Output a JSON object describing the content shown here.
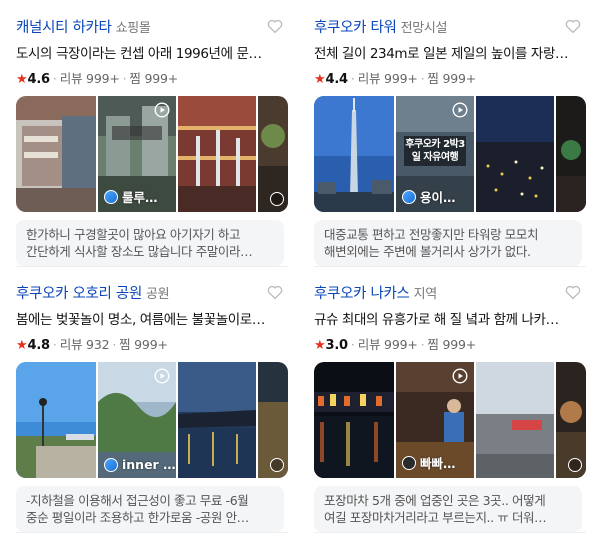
{
  "places": [
    {
      "name": "캐널시티 하카타",
      "category": "쇼핑몰",
      "description": "도시의 극장이라는 컨셉 아래 1996년에 문…",
      "rating": "4.6",
      "reviews": "리뷰 999+",
      "saves": "찜 999+",
      "video_label": "룰루…",
      "review_lines": [
        "한가하니 구경할곳이 많아요 아기자기 하고",
        "간단하게 식사할 장소도 많습니다 주말이라…"
      ]
    },
    {
      "name": "후쿠오카 타워",
      "category": "전망시설",
      "description": "전체 길이 234m로 일본 제일의 높이를 자랑…",
      "rating": "4.4",
      "reviews": "리뷰 999+",
      "saves": "찜 999+",
      "video_label": "용이…",
      "video_caption": "후쿠오카 2박3일 자유여행",
      "review_lines": [
        "대중교통 편하고 전망좋지만 타워랑 모모치",
        "해변외에는 주변에 볼거리사 상가가 없다."
      ]
    },
    {
      "name": "후쿠오카 오호리 공원",
      "category": "공원",
      "description": "봄에는 벚꽃놀이 명소, 여름에는 불꽃놀이로…",
      "rating": "4.8",
      "reviews": "리뷰 932",
      "saves": "찜 999+",
      "video_label": "inner …",
      "review_lines": [
        "-지하철을 이용해서 접근성이 좋고 무료 -6월",
        "중순 평일이라 조용하고 한가로움 -공원 안…"
      ]
    },
    {
      "name": "후쿠오카 나카스",
      "category": "지역",
      "description": "규슈 최대의 유흥가로 해 질 녘과 함께 나카…",
      "rating": "3.0",
      "reviews": "리뷰 999+",
      "saves": "찜 999+",
      "video_label": "빠빠…",
      "review_lines": [
        "포장마차 5개 중에 업중인 곳은 3곳.. 어떻게",
        "여길 포장마차거리라고 부르는지.. ㅠ 더워…"
      ]
    }
  ],
  "colors": {
    "title": "#0b47b8",
    "star": "#e8301c",
    "review_bg": "#f4f5f7"
  },
  "icons": {
    "save": "heart-outline-icon",
    "video": "play-circle-icon",
    "rating": "star-icon"
  }
}
